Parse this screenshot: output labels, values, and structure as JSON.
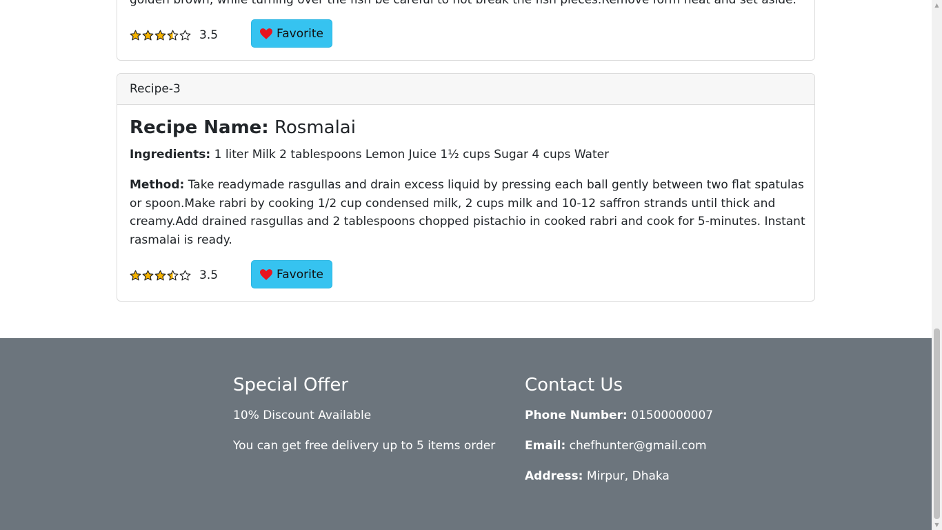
{
  "previous_recipe": {
    "partial_method_text": "golden brown, while turning over the fish be careful to not break the fish pieces.Remove form heat and set aside.",
    "rating": 3.5,
    "rating_text": "3.5",
    "favorite_label": "Favorite"
  },
  "recipe": {
    "header": "Recipe-3",
    "name_label": "Recipe Name:",
    "name": "Rosmalai",
    "ingredients_label": "Ingredients:",
    "ingredients": "1 liter Milk 2 tablespoons Lemon Juice 1½ cups Sugar 4 cups Water",
    "method_label": "Method:",
    "method": "Take readymade rasgullas and drain excess liquid by pressing each ball gently between two flat spatulas or spoon.Make rabri by cooking 1/2 cup condensed milk, 2 cups milk and 10-12 saffron strands until thick and creamy.Add drained rasgullas and 2 tablespoons chopped pistachio in cooked rabri and cook for 5-minutes. Instant rasmalai is ready.",
    "rating": 3.5,
    "rating_text": "3.5",
    "favorite_label": "Favorite"
  },
  "footer": {
    "offer": {
      "title": "Special Offer",
      "line1": "10% Discount Available",
      "line2": "You can get free delivery up to 5 items order"
    },
    "contact": {
      "title": "Contact Us",
      "phone_label": "Phone Number:",
      "phone": "01500000007",
      "email_label": "Email:",
      "email": "chefhunter@gmail.com",
      "address_label": "Address:",
      "address": "Mirpur, Dhaka"
    }
  },
  "colors": {
    "star": "#f5b301",
    "heart": "#e8141f",
    "button": "#36c3f0",
    "footer": "#6c757d"
  },
  "icons": [
    "star-icon",
    "half-star-icon",
    "heart-icon"
  ]
}
